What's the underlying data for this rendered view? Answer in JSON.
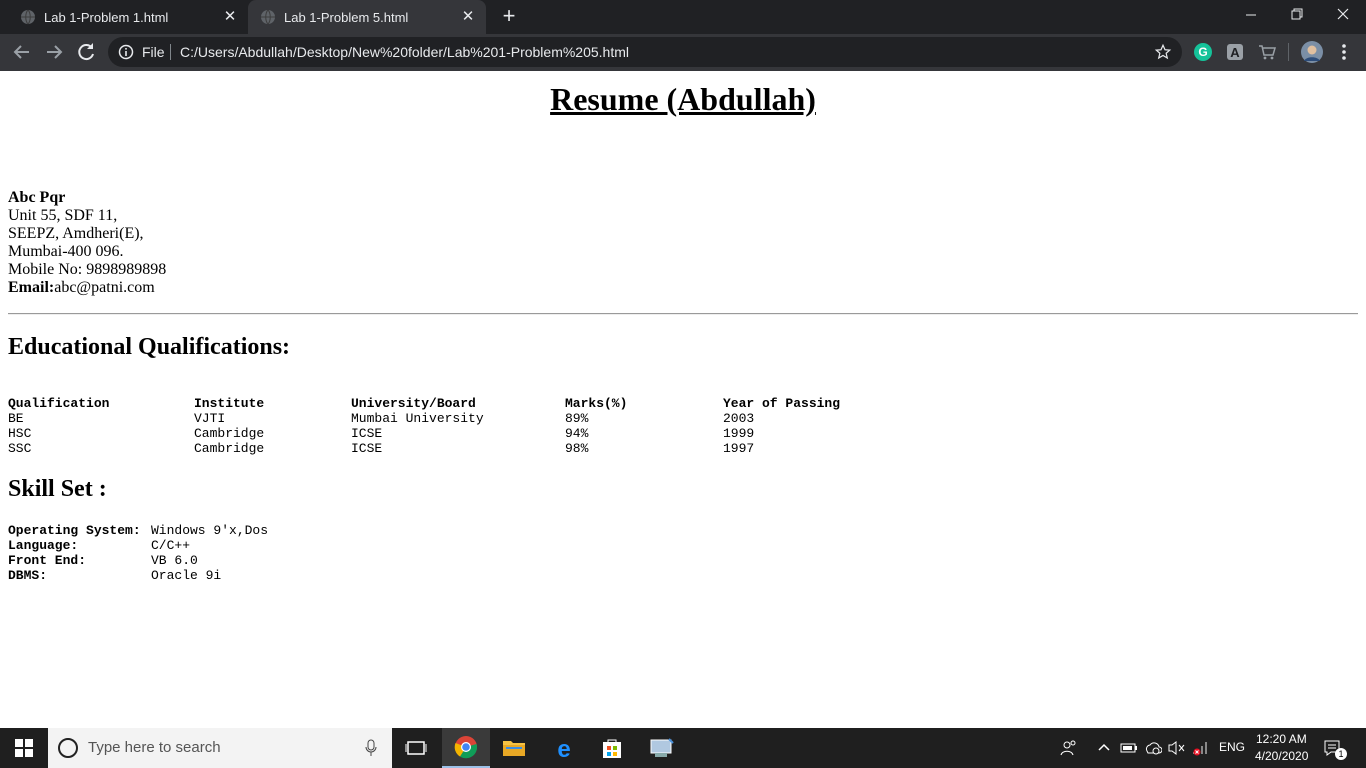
{
  "browser": {
    "tabs": [
      {
        "title": "Lab 1-Problem 1.html",
        "active": false
      },
      {
        "title": "Lab 1-Problem 5.html",
        "active": true
      }
    ],
    "new_tab_label": "+",
    "scheme_label": "File",
    "url": "C:/Users/Abdullah/Desktop/New%20folder/Lab%201-Problem%205.html"
  },
  "page": {
    "title": "Resume (Abdullah)",
    "address": {
      "name": "Abc Pqr",
      "line1": "Unit 55, SDF 11,",
      "line2": "SEEPZ, Amdheri(E),",
      "line3": "Mumbai-400 096.",
      "mobile": "Mobile No: 9898989898",
      "email_label": "Email:",
      "email": "abc@patni.com"
    },
    "education": {
      "heading": "Educational Qualifications:",
      "columns": [
        "Qualification",
        "Institute",
        "University/Board",
        "Marks(%)",
        "Year of Passing"
      ],
      "rows": [
        [
          "BE",
          "VJTI",
          "Mumbai University",
          "89%",
          "2003"
        ],
        [
          "HSC",
          "Cambridge",
          "ICSE",
          "94%",
          "1999"
        ],
        [
          "SSC",
          "Cambridge",
          "ICSE",
          "98%",
          "1997"
        ]
      ]
    },
    "skills": {
      "heading": "Skill Set :",
      "items": [
        {
          "key": "Operating System:",
          "value": "Windows 9'x,Dos"
        },
        {
          "key": "Language:",
          "value": "C/C++"
        },
        {
          "key": "Front End:",
          "value": "VB 6.0"
        },
        {
          "key": "DBMS:",
          "value": "Oracle 9i"
        }
      ]
    }
  },
  "taskbar": {
    "search_placeholder": "Type here to search",
    "language": "ENG",
    "time": "12:20 AM",
    "date": "4/20/2020",
    "notification_count": "1"
  }
}
